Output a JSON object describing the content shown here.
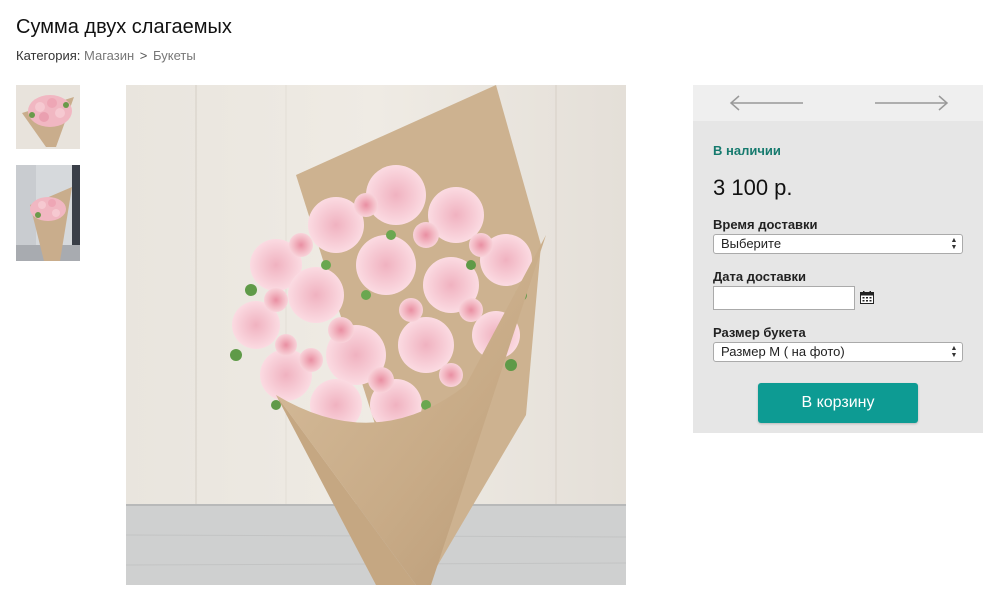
{
  "product": {
    "title": "Сумма двух слагаемых",
    "category_label": "Категория:",
    "breadcrumb": [
      "Магазин",
      "Букеты"
    ],
    "breadcrumb_sep": ">"
  },
  "gallery": {
    "thumbnails": [
      {
        "alt": "bouquet-photo-1",
        "selected": true
      },
      {
        "alt": "bouquet-photo-2",
        "selected": false
      }
    ]
  },
  "purchase": {
    "availability": "В наличии",
    "price": "3 100 р.",
    "delivery_time_label": "Время доставки",
    "delivery_time_value": "Выберите",
    "delivery_date_label": "Дата доставки",
    "delivery_date_value": "",
    "size_label": "Размер букета",
    "size_value": "Размер M ( на фото)",
    "cart_button": "В корзину"
  },
  "colors": {
    "accent": "#0d9b93",
    "availability": "#167a6e",
    "panel_bg": "#e6e6e6"
  },
  "icons": [
    "arrow-left-icon",
    "arrow-right-icon",
    "calendar-icon",
    "select-caret-icon"
  ]
}
